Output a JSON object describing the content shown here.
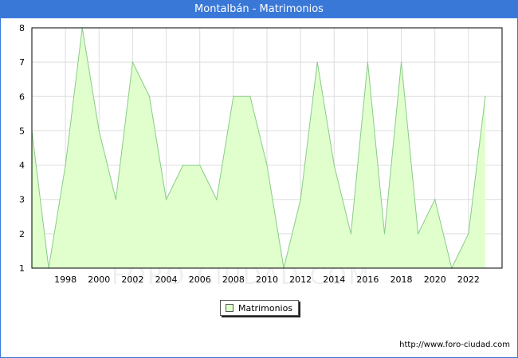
{
  "title": "Montalbán - Matrimonios",
  "source_url": "http://www.foro-ciudad.com",
  "watermark": "FORO-CIUDAD.COM",
  "colors": {
    "accent": "#3a78d8",
    "fill": "#e0ffcc",
    "line": "#88cc88",
    "grid": "#dddddd"
  },
  "chart_data": {
    "type": "area",
    "title": "Montalbán - Matrimonios",
    "xlabel": "",
    "ylabel": "",
    "x": [
      1996,
      1997,
      1998,
      1999,
      2000,
      2001,
      2002,
      2003,
      2004,
      2005,
      2006,
      2007,
      2008,
      2009,
      2010,
      2011,
      2012,
      2013,
      2014,
      2015,
      2016,
      2017,
      2018,
      2019,
      2020,
      2021,
      2022,
      2023
    ],
    "series": [
      {
        "name": "Matrimonios",
        "values": [
          5,
          1,
          4,
          8,
          5,
          3,
          7,
          6,
          3,
          4,
          4,
          3,
          6,
          6,
          4,
          1,
          3,
          7,
          4,
          2,
          7,
          2,
          7,
          2,
          3,
          1,
          2,
          6
        ]
      }
    ],
    "xlim": [
      1996,
      2024
    ],
    "ylim": [
      1,
      8
    ],
    "x_ticks": [
      1998,
      2000,
      2002,
      2004,
      2006,
      2008,
      2010,
      2012,
      2014,
      2016,
      2018,
      2020,
      2022
    ],
    "y_ticks": [
      1,
      2,
      3,
      4,
      5,
      6,
      7,
      8
    ],
    "grid": true,
    "legend": "bottom-center"
  }
}
